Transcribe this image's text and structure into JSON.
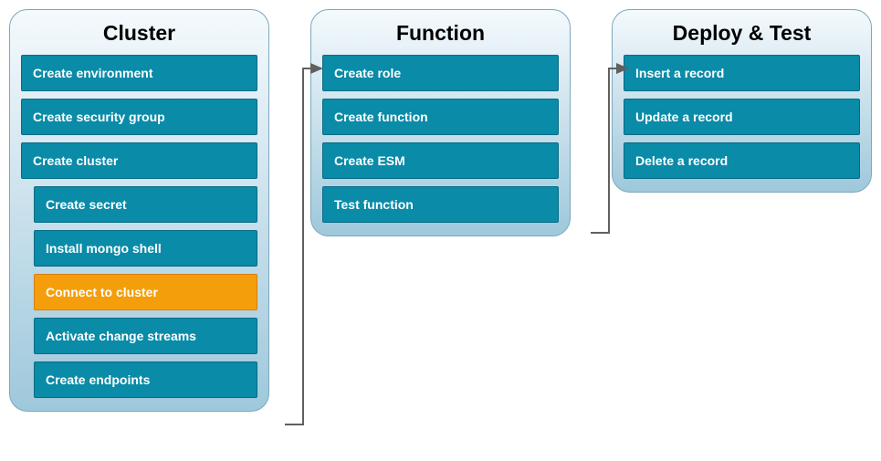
{
  "panels": [
    {
      "title": "Cluster",
      "steps": [
        {
          "label": "Create environment",
          "indented": false,
          "highlighted": false
        },
        {
          "label": "Create security group",
          "indented": false,
          "highlighted": false
        },
        {
          "label": "Create cluster",
          "indented": false,
          "highlighted": false
        },
        {
          "label": "Create secret",
          "indented": true,
          "highlighted": false
        },
        {
          "label": "Install mongo shell",
          "indented": true,
          "highlighted": false
        },
        {
          "label": "Connect to cluster",
          "indented": true,
          "highlighted": true
        },
        {
          "label": "Activate change streams",
          "indented": true,
          "highlighted": false
        },
        {
          "label": "Create endpoints",
          "indented": true,
          "highlighted": false
        }
      ]
    },
    {
      "title": "Function",
      "steps": [
        {
          "label": "Create role",
          "indented": false,
          "highlighted": false
        },
        {
          "label": "Create function",
          "indented": false,
          "highlighted": false
        },
        {
          "label": "Create ESM",
          "indented": false,
          "highlighted": false
        },
        {
          "label": "Test function",
          "indented": false,
          "highlighted": false
        }
      ]
    },
    {
      "title": "Deploy & Test",
      "steps": [
        {
          "label": "Insert a record",
          "indented": false,
          "highlighted": false
        },
        {
          "label": "Update a record",
          "indented": false,
          "highlighted": false
        },
        {
          "label": "Delete a record",
          "indented": false,
          "highlighted": false
        }
      ]
    }
  ]
}
